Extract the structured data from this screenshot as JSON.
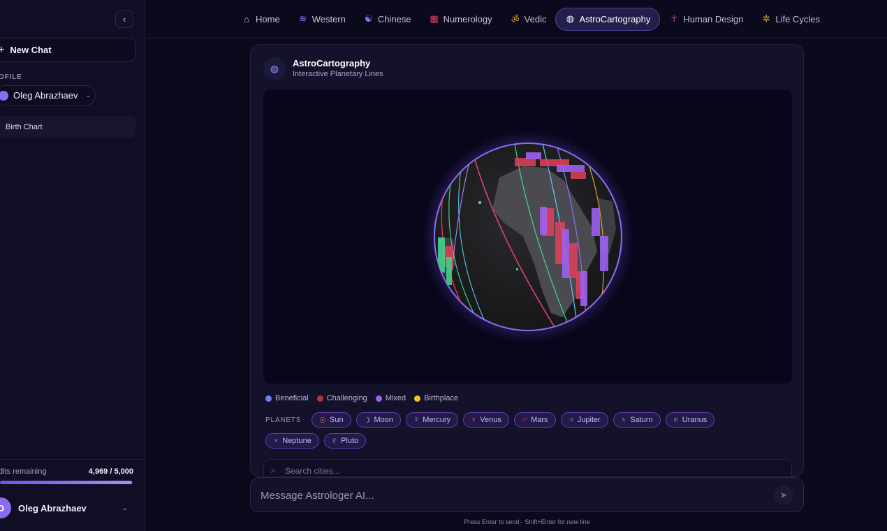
{
  "sidebar": {
    "collapse_icon": "chevron-left-icon",
    "new_chat_label": "New Chat",
    "profile_label": "OFILE",
    "profile_name": "Oleg Abrazhaev",
    "birth_chart_label": "Birth Chart",
    "credits_label": "dits remaining",
    "credits_value": "4,969 / 5,000",
    "credits_fraction": 0.9938,
    "user_initial": "O",
    "user_name": "Oleg Abrazhaev"
  },
  "nav": {
    "items": [
      {
        "label": "Home",
        "icon": "home-icon",
        "glyph": "⌂",
        "color": "#c4c1da",
        "active": false
      },
      {
        "label": "Western",
        "icon": "waves-icon",
        "glyph": "≋",
        "color": "#8d6cf4",
        "active": false
      },
      {
        "label": "Chinese",
        "icon": "yin-yang-icon",
        "glyph": "☯",
        "color": "#7a8cff",
        "active": false
      },
      {
        "label": "Numerology",
        "icon": "grid-icon",
        "glyph": "▦",
        "color": "#e0405a",
        "active": false
      },
      {
        "label": "Vedic",
        "icon": "om-icon",
        "glyph": "ॐ",
        "color": "#e89a2c",
        "active": false
      },
      {
        "label": "AstroCartography",
        "icon": "globe-icon",
        "glyph": "◍",
        "color": "#ffffff",
        "active": true
      },
      {
        "label": "Human Design",
        "icon": "human-icon",
        "glyph": "☥",
        "color": "#e0407a",
        "active": false
      },
      {
        "label": "Life Cycles",
        "icon": "sun-icon",
        "glyph": "✲",
        "color": "#e8b82c",
        "active": false
      }
    ]
  },
  "card": {
    "icon": "globe-icon",
    "title": "AstroCartography",
    "subtitle": "Interactive Planetary Lines"
  },
  "legend": [
    {
      "label": "Beneficial",
      "color": "#6f7ff0"
    },
    {
      "label": "Challenging",
      "color": "#c0303a"
    },
    {
      "label": "Mixed",
      "color": "#9b62ee"
    },
    {
      "label": "Birthplace",
      "color": "#f0c427"
    }
  ],
  "planets": {
    "label": "PLANETS",
    "items": [
      {
        "label": "Sun",
        "glyph": "☉",
        "icon": "sun-symbol-icon",
        "color": "#e89a2c"
      },
      {
        "label": "Moon",
        "glyph": "☽",
        "icon": "moon-symbol-icon",
        "color": "#c7b5ff"
      },
      {
        "label": "Mercury",
        "glyph": "☿",
        "icon": "mercury-symbol-icon",
        "color": "#b88cff"
      },
      {
        "label": "Venus",
        "glyph": "♀",
        "icon": "venus-symbol-icon",
        "color": "#e070c8"
      },
      {
        "label": "Mars",
        "glyph": "♂",
        "icon": "mars-symbol-icon",
        "color": "#e0405a"
      },
      {
        "label": "Jupiter",
        "glyph": "♃",
        "icon": "jupiter-symbol-icon",
        "color": "#3fd08a"
      },
      {
        "label": "Saturn",
        "glyph": "♄",
        "icon": "saturn-symbol-icon",
        "color": "#58c6e8"
      },
      {
        "label": "Uranus",
        "glyph": "♅",
        "icon": "uranus-symbol-icon",
        "color": "#58c6e8"
      },
      {
        "label": "Neptune",
        "glyph": "♆",
        "icon": "neptune-symbol-icon",
        "color": "#a292f5"
      },
      {
        "label": "Pluto",
        "glyph": "♇",
        "icon": "pluto-symbol-icon",
        "color": "#c7b5ff"
      }
    ]
  },
  "search": {
    "placeholder": "Search cities..."
  },
  "composer": {
    "placeholder": "Message Astrologer AI...",
    "send_icon": "send-icon",
    "hint": "Press Enter to send · Shift+Enter for new line"
  }
}
